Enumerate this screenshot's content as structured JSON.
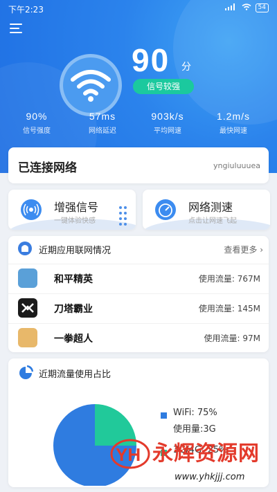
{
  "status_bar": {
    "time": "下午2:23",
    "signal": "...ll",
    "wifi": "wifi",
    "battery": "54"
  },
  "header": {
    "menu_icon": "menu-icon",
    "wifi_icon": "wifi-icon",
    "score": "90",
    "score_unit": "分",
    "strength_label": "信号较强"
  },
  "stats": [
    {
      "value": "90%",
      "label": "信号强度"
    },
    {
      "value": "57ms",
      "label": "网络延迟"
    },
    {
      "value": "903k/s",
      "label": "平均网速"
    },
    {
      "value": "1.2m/s",
      "label": "最快网速"
    }
  ],
  "connected": {
    "title": "已连接网络",
    "ssid": "yngiuluuuea"
  },
  "features": {
    "boost": {
      "title": "增强信号",
      "subtitle": "一键体验快感",
      "icon": "signal-boost-icon"
    },
    "speedtest": {
      "title": "网络测速",
      "subtitle": "点击让网速飞起",
      "icon": "speedometer-icon"
    }
  },
  "apps": {
    "title": "近期应用联网情况",
    "more": "查看更多",
    "usage_label": "使用流量:",
    "items": [
      {
        "name": "和平精英",
        "usage": "767M",
        "icon": "game-icon",
        "color": "#5aa0d8"
      },
      {
        "name": "刀塔霸业",
        "usage": "145M",
        "icon": "game-icon",
        "color": "#1b1b1b"
      },
      {
        "name": "一拳超人",
        "usage": "97M",
        "icon": "game-icon",
        "color": "#e8b86a"
      }
    ]
  },
  "traffic": {
    "title": "近期流量使用占比",
    "colors": {
      "wifi": "#2f7ce0",
      "cellular": "#21c99a"
    }
  },
  "chart_data": {
    "type": "pie",
    "title": "近期流量使用占比",
    "categories": [
      "WiFi",
      "3G/4G"
    ],
    "values": [
      75,
      25
    ],
    "legend": [
      {
        "label": "WiFi:",
        "percent": "75%",
        "usage_label": "使用量:",
        "usage": "3G"
      },
      {
        "label": "3G/4G:",
        "percent": "25%"
      }
    ]
  },
  "watermark": {
    "text": "永辉资源网",
    "url": "www.yhkjjj.com",
    "logo": "YH"
  }
}
